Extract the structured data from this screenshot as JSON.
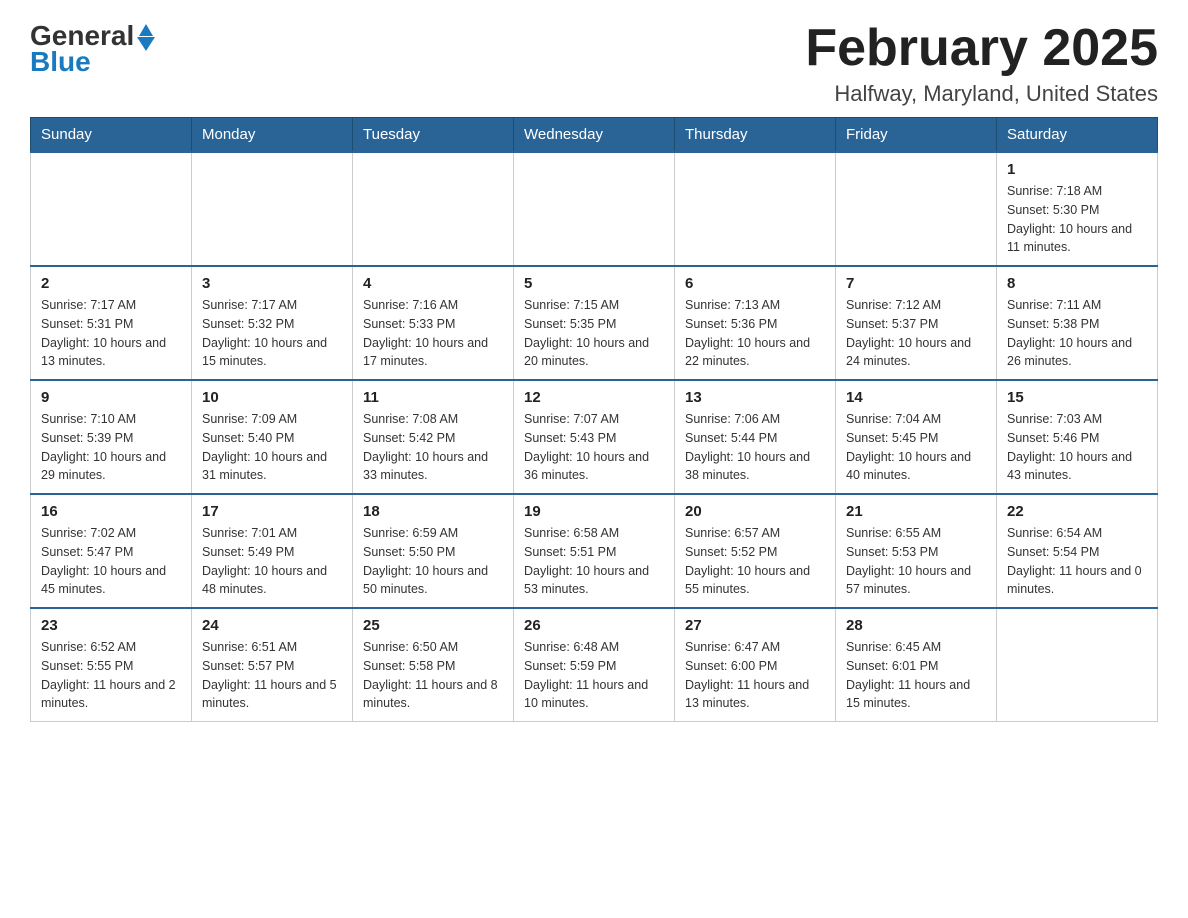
{
  "header": {
    "logo_general": "General",
    "logo_blue": "Blue",
    "month_title": "February 2025",
    "location": "Halfway, Maryland, United States"
  },
  "weekdays": [
    "Sunday",
    "Monday",
    "Tuesday",
    "Wednesday",
    "Thursday",
    "Friday",
    "Saturday"
  ],
  "weeks": [
    [
      {
        "day": "",
        "info": ""
      },
      {
        "day": "",
        "info": ""
      },
      {
        "day": "",
        "info": ""
      },
      {
        "day": "",
        "info": ""
      },
      {
        "day": "",
        "info": ""
      },
      {
        "day": "",
        "info": ""
      },
      {
        "day": "1",
        "info": "Sunrise: 7:18 AM\nSunset: 5:30 PM\nDaylight: 10 hours and 11 minutes."
      }
    ],
    [
      {
        "day": "2",
        "info": "Sunrise: 7:17 AM\nSunset: 5:31 PM\nDaylight: 10 hours and 13 minutes."
      },
      {
        "day": "3",
        "info": "Sunrise: 7:17 AM\nSunset: 5:32 PM\nDaylight: 10 hours and 15 minutes."
      },
      {
        "day": "4",
        "info": "Sunrise: 7:16 AM\nSunset: 5:33 PM\nDaylight: 10 hours and 17 minutes."
      },
      {
        "day": "5",
        "info": "Sunrise: 7:15 AM\nSunset: 5:35 PM\nDaylight: 10 hours and 20 minutes."
      },
      {
        "day": "6",
        "info": "Sunrise: 7:13 AM\nSunset: 5:36 PM\nDaylight: 10 hours and 22 minutes."
      },
      {
        "day": "7",
        "info": "Sunrise: 7:12 AM\nSunset: 5:37 PM\nDaylight: 10 hours and 24 minutes."
      },
      {
        "day": "8",
        "info": "Sunrise: 7:11 AM\nSunset: 5:38 PM\nDaylight: 10 hours and 26 minutes."
      }
    ],
    [
      {
        "day": "9",
        "info": "Sunrise: 7:10 AM\nSunset: 5:39 PM\nDaylight: 10 hours and 29 minutes."
      },
      {
        "day": "10",
        "info": "Sunrise: 7:09 AM\nSunset: 5:40 PM\nDaylight: 10 hours and 31 minutes."
      },
      {
        "day": "11",
        "info": "Sunrise: 7:08 AM\nSunset: 5:42 PM\nDaylight: 10 hours and 33 minutes."
      },
      {
        "day": "12",
        "info": "Sunrise: 7:07 AM\nSunset: 5:43 PM\nDaylight: 10 hours and 36 minutes."
      },
      {
        "day": "13",
        "info": "Sunrise: 7:06 AM\nSunset: 5:44 PM\nDaylight: 10 hours and 38 minutes."
      },
      {
        "day": "14",
        "info": "Sunrise: 7:04 AM\nSunset: 5:45 PM\nDaylight: 10 hours and 40 minutes."
      },
      {
        "day": "15",
        "info": "Sunrise: 7:03 AM\nSunset: 5:46 PM\nDaylight: 10 hours and 43 minutes."
      }
    ],
    [
      {
        "day": "16",
        "info": "Sunrise: 7:02 AM\nSunset: 5:47 PM\nDaylight: 10 hours and 45 minutes."
      },
      {
        "day": "17",
        "info": "Sunrise: 7:01 AM\nSunset: 5:49 PM\nDaylight: 10 hours and 48 minutes."
      },
      {
        "day": "18",
        "info": "Sunrise: 6:59 AM\nSunset: 5:50 PM\nDaylight: 10 hours and 50 minutes."
      },
      {
        "day": "19",
        "info": "Sunrise: 6:58 AM\nSunset: 5:51 PM\nDaylight: 10 hours and 53 minutes."
      },
      {
        "day": "20",
        "info": "Sunrise: 6:57 AM\nSunset: 5:52 PM\nDaylight: 10 hours and 55 minutes."
      },
      {
        "day": "21",
        "info": "Sunrise: 6:55 AM\nSunset: 5:53 PM\nDaylight: 10 hours and 57 minutes."
      },
      {
        "day": "22",
        "info": "Sunrise: 6:54 AM\nSunset: 5:54 PM\nDaylight: 11 hours and 0 minutes."
      }
    ],
    [
      {
        "day": "23",
        "info": "Sunrise: 6:52 AM\nSunset: 5:55 PM\nDaylight: 11 hours and 2 minutes."
      },
      {
        "day": "24",
        "info": "Sunrise: 6:51 AM\nSunset: 5:57 PM\nDaylight: 11 hours and 5 minutes."
      },
      {
        "day": "25",
        "info": "Sunrise: 6:50 AM\nSunset: 5:58 PM\nDaylight: 11 hours and 8 minutes."
      },
      {
        "day": "26",
        "info": "Sunrise: 6:48 AM\nSunset: 5:59 PM\nDaylight: 11 hours and 10 minutes."
      },
      {
        "day": "27",
        "info": "Sunrise: 6:47 AM\nSunset: 6:00 PM\nDaylight: 11 hours and 13 minutes."
      },
      {
        "day": "28",
        "info": "Sunrise: 6:45 AM\nSunset: 6:01 PM\nDaylight: 11 hours and 15 minutes."
      },
      {
        "day": "",
        "info": ""
      }
    ]
  ]
}
